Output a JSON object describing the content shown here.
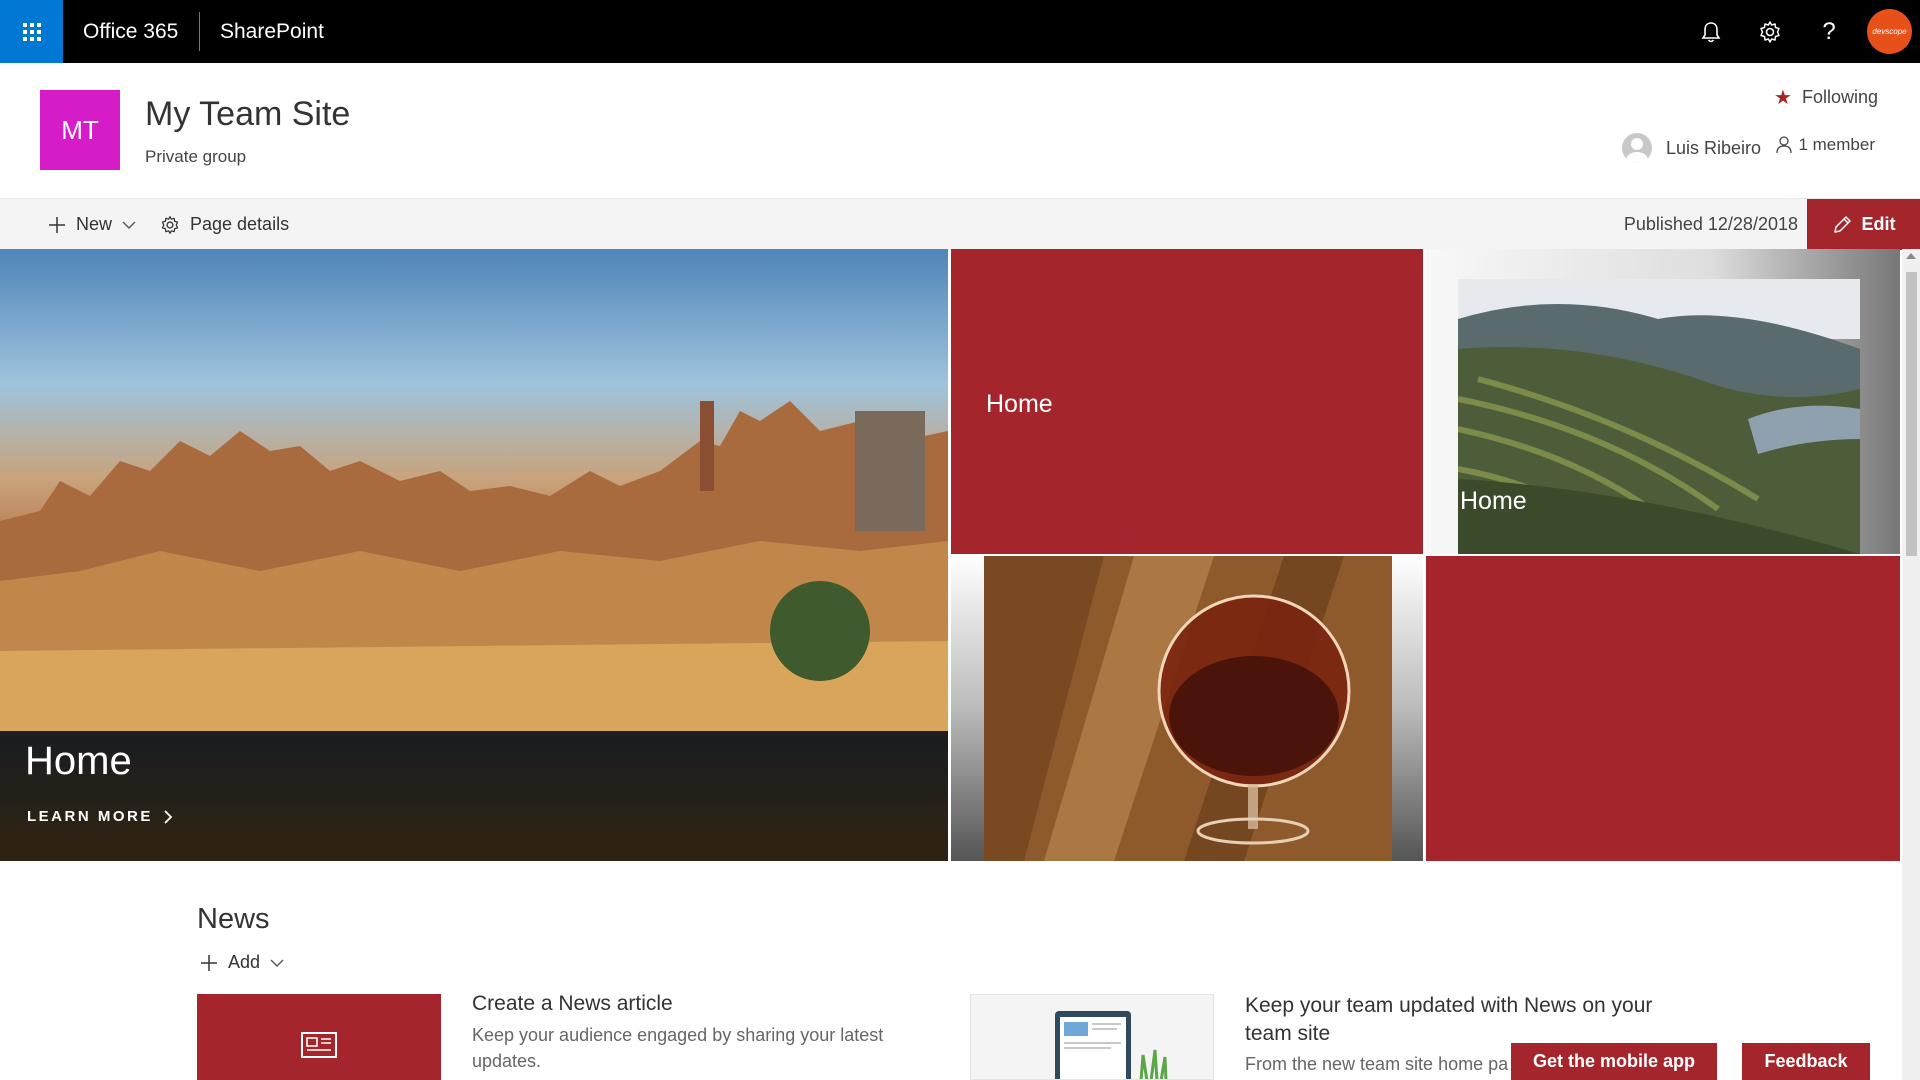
{
  "suitebar": {
    "app_name": "Office 365",
    "product": "SharePoint",
    "avatar_text": "devscope",
    "icons": [
      "waffle-icon",
      "bell-icon",
      "gear-icon",
      "help-icon"
    ],
    "colors": {
      "bar": "#000000",
      "waffle": "#0078d4",
      "avatar": "#e8501a"
    }
  },
  "site": {
    "logo_initials": "MT",
    "title": "My Team Site",
    "subtitle": "Private group",
    "following_label": "Following",
    "owner_name": "Luis Ribeiro",
    "members_label": "1 member",
    "colors": {
      "logo": "#d61cc8",
      "accent": "#a4262c"
    }
  },
  "commandbar": {
    "new_label": "New",
    "page_details_label": "Page details",
    "published": "Published 12/28/2018",
    "edit_label": "Edit"
  },
  "hero": {
    "main_title": "Home",
    "main_link": "LEARN MORE",
    "tiles": [
      {
        "label": "Home"
      },
      {
        "label": "Home"
      },
      {
        "label": ""
      },
      {
        "label": ""
      }
    ]
  },
  "news": {
    "title": "News",
    "add_label": "Add",
    "card1_heading": "Create a News article",
    "card1_text": "Keep your audience engaged by sharing your latest updates.",
    "card2_heading": "Keep your team updated with News on your team site",
    "card2_text": "From the new team site home pa"
  },
  "floating": {
    "mobile_app": "Get the mobile app",
    "feedback": "Feedback"
  }
}
